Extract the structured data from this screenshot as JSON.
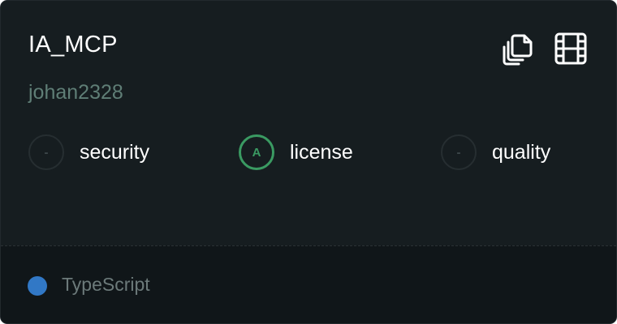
{
  "repo": {
    "name": "IA_MCP",
    "owner": "johan2328"
  },
  "actions": {
    "copy_icon": "copy-icon",
    "video_icon": "film-icon"
  },
  "scores": [
    {
      "grade": "-",
      "label": "security",
      "status": "none"
    },
    {
      "grade": "A",
      "label": "license",
      "status": "good"
    },
    {
      "grade": "-",
      "label": "quality",
      "status": "none"
    }
  ],
  "footer": {
    "language": "TypeScript",
    "language_color": "#3178c6"
  },
  "colors": {
    "card_background": "#161d20",
    "footer_background": "#101619",
    "owner_text": "#5f7e76",
    "grade_a": "#3a9a62"
  }
}
